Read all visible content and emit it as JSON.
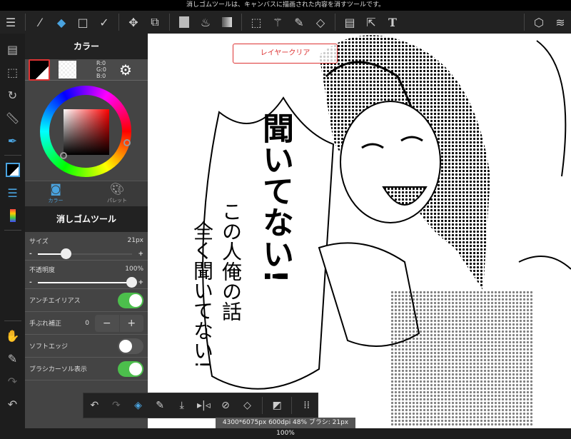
{
  "status_message": "消しゴムツールは、キャンバスに描画された内容を消すツールです。",
  "toolbar": {
    "icons": [
      "menu-icon",
      "brush-icon",
      "eraser-icon",
      "shape-icon",
      "correction-icon",
      "move-icon",
      "transform-icon",
      "fill-color-icon",
      "bucket-icon",
      "gradient-icon",
      "select-icon",
      "magic-wand-icon",
      "select-pen-icon",
      "select-eraser-icon",
      "frame-icon",
      "object-select-icon",
      "text-icon",
      "3d-model-icon",
      "layers-icon"
    ],
    "text_label": "T"
  },
  "left_icons": [
    "pages-icon",
    "selection-icon",
    "rotate-icon",
    "ruler-icon",
    "brush-tool-icon",
    "color-swatch-icon",
    "layer-list-icon",
    "color-bar-icon",
    "hand-icon",
    "eyedropper-icon",
    "redo-icon",
    "undo-icon"
  ],
  "color_panel": {
    "title": "カラー",
    "r": "R:0",
    "g": "G:0",
    "b": "B:0",
    "fg": "#000000",
    "tab_color": "カラー",
    "tab_palette": "パレット",
    "hue": "#ff0000"
  },
  "tool_panel": {
    "title": "消しゴムツール",
    "size_label": "サイズ",
    "size_value": "21px",
    "size_fraction": 0.3,
    "opacity_label": "不透明度",
    "opacity_value": "100%",
    "opacity_fraction": 1.0,
    "minus": "-",
    "plus": "+",
    "antialias_label": "アンチエイリアス",
    "antialias_on": true,
    "stabilizer_label": "手ぶれ補正",
    "stabilizer_value": "0",
    "soft_edge_label": "ソフトエッジ",
    "soft_edge_on": false,
    "cursor_label": "ブラシカーソル表示",
    "cursor_on": true
  },
  "canvas": {
    "clear_button": "レイヤークリア",
    "text1": "聞いてない!",
    "text2": "この人俺の話",
    "text3": "全く聞いてない!"
  },
  "bottom_icons": [
    "undo-icon",
    "redo-icon",
    "eraser-select-icon",
    "pen-icon",
    "import-icon",
    "flip-icon",
    "no-snap-icon",
    "clear-icon",
    "share-icon",
    "grid-dots-icon"
  ],
  "info": "4300*6075px 600dpi 48% ブラシ: 21px 100%",
  "accent": "#4cbf4c"
}
